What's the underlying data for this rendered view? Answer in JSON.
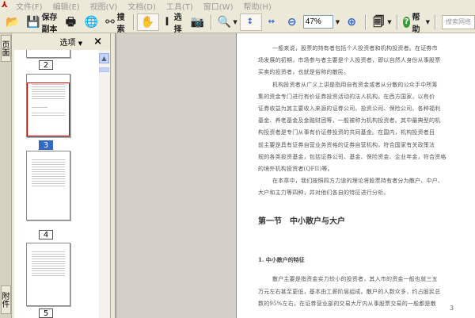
{
  "menu": [
    "文件(F)",
    "编辑(E)",
    "视图(V)",
    "文档(D)",
    "工具(T)",
    "窗口(W)",
    "帮助(H)"
  ],
  "toolbar": {
    "save_copy": "保存副本",
    "search": "搜索",
    "select": "选择",
    "zoom": "47%",
    "help": "帮助",
    "search_placeholder": "搜索网络"
  },
  "sidebar": {
    "tab_pages": "页面",
    "tab_attachments": "附件",
    "options": "选项",
    "close": "×",
    "pages": [
      "2",
      "3",
      "4",
      "5"
    ],
    "selected_page": "3"
  },
  "document": {
    "lines": [
      "一般来说，股票的持有者包括个人投资者和机构投资者。在证券市",
      "场发展的初期，市场参与者主要是个人投资者，即以自然人身份从事股票",
      "买卖的投资者，也就是俗称的散民。",
      "机构投资者从广义上讲是指用自有资金或者从分散的公众手中所筹",
      "集的资金专门进行有价证券投资活动的法人机构。在西方国家，以有价",
      "证券收益为其主要收入来源的证券公司、投资公司、保险公司、各种福利",
      "基金、养老基金及金融财团等，一般被称为机构投资者。其中最典型的机",
      "构投资者是专门从事有价证券投资的共同基金。在国内，机构投资者目",
      "前主要是具有证券自营业务资格的证券自营机构，符合国家有关政策法",
      "规的各类投资基金，包括证券公司、基金、保险资金、企业年金，符合资格",
      "的境外机构投资者(QFII)等。",
      "在本章中，我们按照四方力道的理论将股票持有者分为散户、中户、",
      "大户和主力等四种，并对他们各自的特征进行分析。"
    ],
    "heading": "第一节　中小散户与大户",
    "subheading": "1. 中小散户的特征",
    "lines2": [
      "散户主要是指资金实力较小的投资者，其入市的资金一般也就三五",
      "万元左右甚至更低，基本由工薪阶层组成。散户的人数众多，约占股民总",
      "数的95%左右，在证券营业部的交易大厅内从事股票交易的一般都是散"
    ],
    "page_number": "3"
  }
}
